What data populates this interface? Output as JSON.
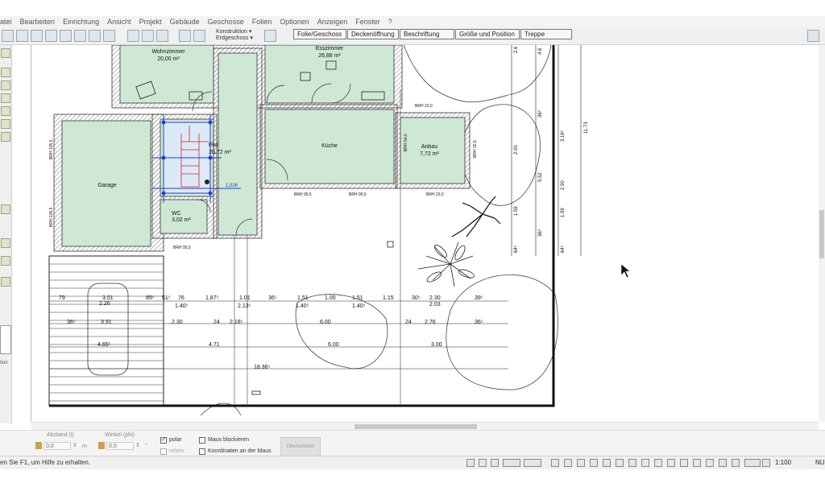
{
  "menu": [
    "atei",
    "Bearbeiten",
    "Einrichtung",
    "Ansicht",
    "Projekt",
    "Gebäude",
    "Geschosse",
    "Folien",
    "Optionen",
    "Anzeigen",
    "Fenster",
    "?"
  ],
  "layers": {
    "folie": "Konstruktion",
    "geschoss": "Erdgeschoss"
  },
  "tabs": [
    "Folie/Geschoss",
    "Deckenöffnung",
    "Beschriftung",
    "Größe und Position",
    "Treppe"
  ],
  "rooms": [
    {
      "name": "Wohnzimmer",
      "area": "20,00 m²"
    },
    {
      "name": "Esszimmer",
      "area": "26,88 m²"
    },
    {
      "name": "Flur",
      "area": "20,72 m²"
    },
    {
      "name": "Küche",
      "area": ""
    },
    {
      "name": "Anbau",
      "area": "7,72 m²"
    },
    {
      "name": "Garage",
      "area": ""
    },
    {
      "name": "WC",
      "area": "3,02 m²"
    }
  ],
  "brh_labels": [
    "BRH 23,0",
    "BRH 95,5",
    "BRH 95,5",
    "BRH 23,0",
    "BRH 95,5",
    "BRH 105,5",
    "BRH 105,5",
    "BRH 50,0",
    "BRH 32,5"
  ],
  "stair_dim": "1,026",
  "dims": {
    "row1": [
      "79",
      "3.01",
      "85⁵",
      "51⁵",
      "76",
      "1.87⁵",
      "1.01",
      "36⁵",
      "1.51",
      "1.00",
      "1.51",
      "1.15",
      "30⁵",
      "2.30",
      "39⁵"
    ],
    "row1b": [
      "2.26",
      "1.40⁵",
      "2.13⁵",
      "1.40⁵",
      "1.40⁵",
      "2.03"
    ],
    "row2": [
      "36⁵",
      "3.91",
      "2.30",
      "24",
      "2.18⁵",
      "6.00",
      "24",
      "2.76",
      "36⁵"
    ],
    "row3": [
      "4.65⁵",
      "4.71",
      "6.00",
      "3.00"
    ],
    "total": "18.36⁵",
    "right": [
      "2.6",
      "4.6",
      "11.73",
      "3.16⁵",
      "5.52",
      "2.00",
      "2.90",
      "1.59",
      "1.99",
      "64⁵",
      "64⁵",
      "36⁵",
      "36⁵"
    ]
  },
  "coord": {
    "abstand_label": "Abstand (l)",
    "abstand_value": "0,0",
    "abstand_unit": "m",
    "winkel_label": "Winkel (phi)",
    "winkel_value": "0,0",
    "winkel_unit": "°",
    "polar": "polar",
    "relativ": "relativ",
    "maus_blockieren": "Maus blockieren",
    "koordinaten": "Koordinaten an der Maus",
    "uebernehmen": "Übernehmen"
  },
  "left_label": "tion",
  "status": {
    "help": "en Sie F1, um Hilfe zu erhalten.",
    "scale": "1:100",
    "extra": "NU"
  },
  "colors": {
    "room": "#cfe8d4",
    "wall": "#9a9a9a",
    "dim": "#222222",
    "selection": "#1a3fd8",
    "stair": "#cc2a1a"
  }
}
